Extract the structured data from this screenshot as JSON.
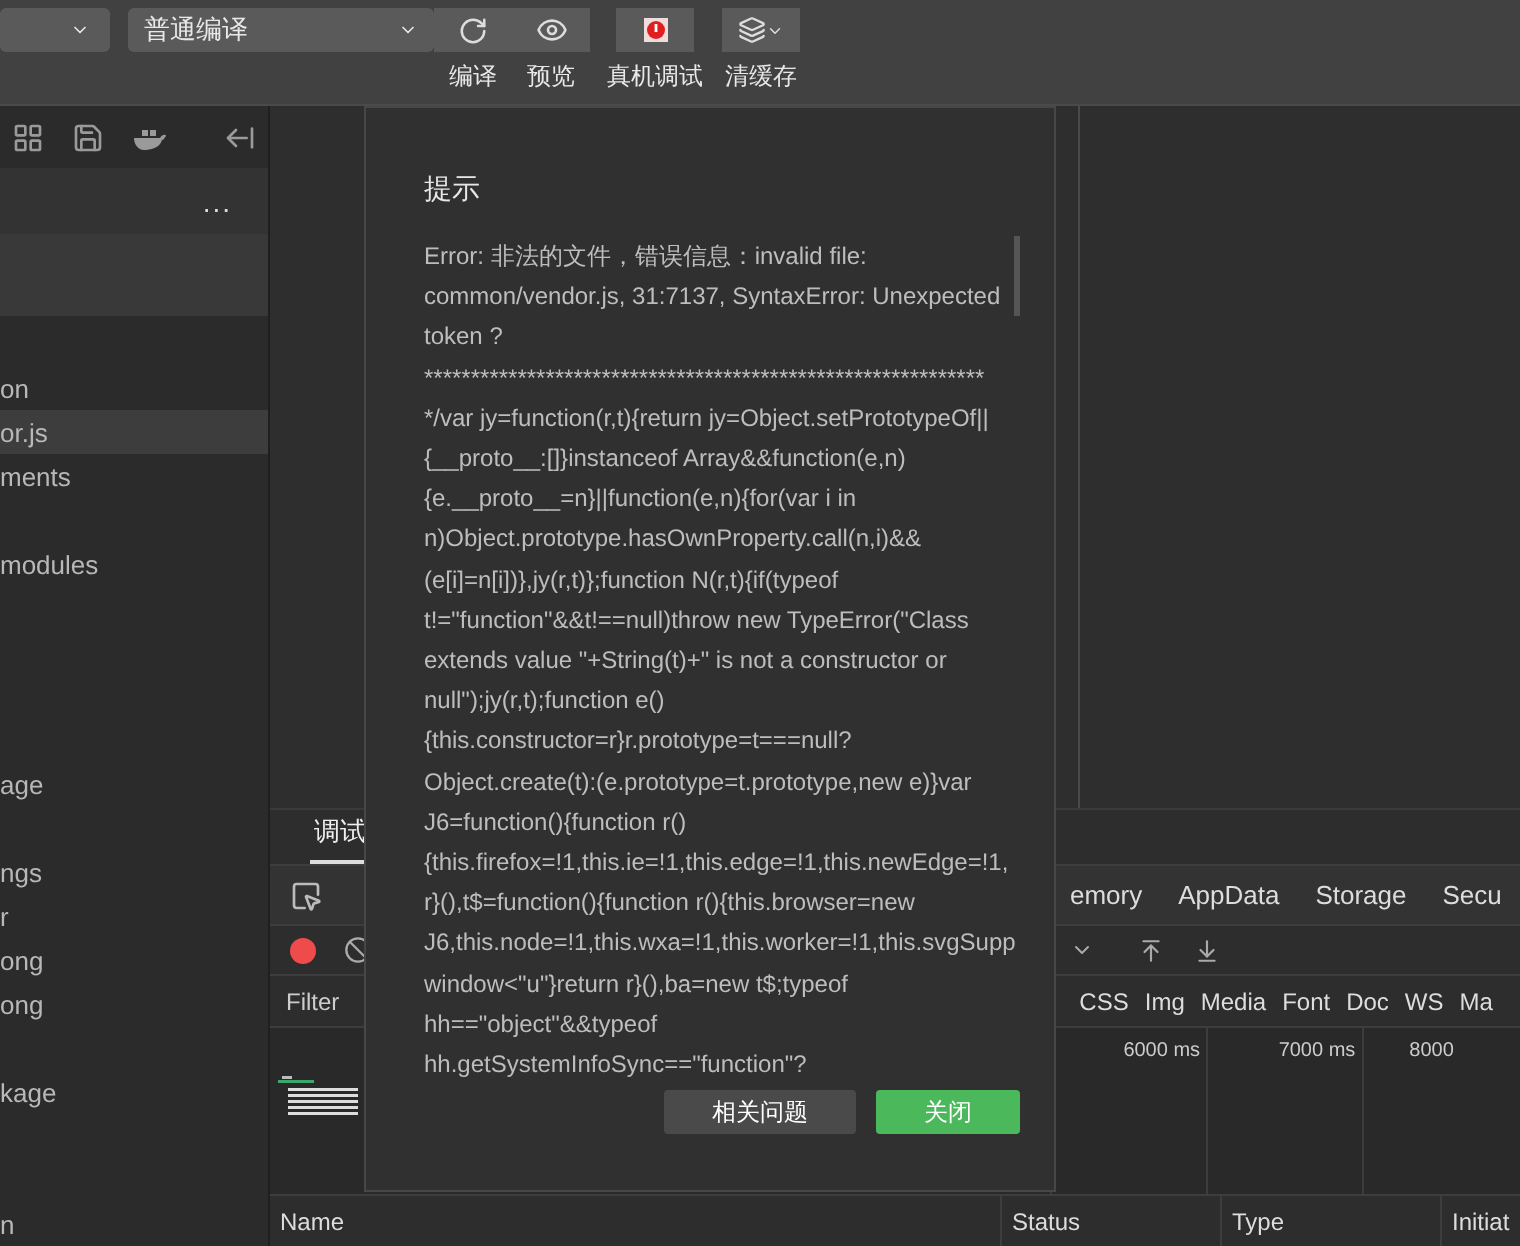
{
  "toolbar": {
    "mode_dropdown": {
      "value": "普通编译"
    },
    "buttons": [
      {
        "kind": "compile",
        "label": "编译"
      },
      {
        "kind": "preview",
        "label": "预览"
      },
      {
        "kind": "device",
        "label": "真机调试"
      },
      {
        "kind": "cache",
        "label": "清缓存"
      }
    ]
  },
  "sidebar": {
    "menu": "...",
    "files": [
      {
        "name": "on",
        "selected": false
      },
      {
        "name": "or.js",
        "selected": true
      },
      {
        "name": "ments",
        "selected": false
      },
      {
        "name": "modules",
        "selected": false
      },
      {
        "name": "age",
        "selected": false
      },
      {
        "name": "ngs",
        "selected": false
      },
      {
        "name": "r",
        "selected": false
      },
      {
        "name": "ong",
        "selected": false
      },
      {
        "name": "ong",
        "selected": false
      },
      {
        "name": "kage",
        "selected": false
      },
      {
        "name": "n",
        "selected": false
      }
    ]
  },
  "debugger": {
    "tabs": [
      {
        "label": "调试",
        "selected": true
      }
    ],
    "panels": [
      "emory",
      "AppData",
      "Storage",
      "Secu"
    ],
    "filter": "Filter",
    "types": [
      "CSS",
      "Img",
      "Media",
      "Font",
      "Doc",
      "WS",
      "Ma"
    ],
    "ticks": [
      "6000 ms",
      "7000 ms",
      "8000"
    ],
    "columns": [
      "Name",
      "Status",
      "Type",
      "Initiat"
    ]
  },
  "dialog": {
    "title": "提示",
    "lines": [
      "Error: 非法的文件，错误信息：invalid file:",
      "common/vendor.js, 31:7137, SyntaxError: Unexpected",
      "token ?",
      "************************************************************",
      "*/var jy=function(r,t){return jy=Object.setPrototypeOf||",
      "{__proto__:[]}instanceof Array&&function(e,n)",
      "{e.__proto__=n}||function(e,n){for(var i in",
      "n)Object.prototype.hasOwnProperty.call(n,i)&&",
      "(e[i]=n[i])},jy(r,t)};function N(r,t){if(typeof",
      "t!=\"function\"&&t!==null)throw new TypeError(\"Class",
      "extends value \"+String(t)+\" is not a constructor or",
      "null\");jy(r,t);function e()",
      "{this.constructor=r}r.prototype=t===null?",
      "Object.create(t):(e.prototype=t.prototype,new e)}var",
      "J6=function(){function r()",
      "{this.firefox=!1,this.ie=!1,this.edge=!1,this.newEdge=!1,",
      "r}(),t$=function(){function r(){this.browser=new",
      "J6,this.node=!1,this.wxa=!1,this.worker=!1,this.svgSupp",
      "window<\"u\"}return r}(),ba=new t$;typeof",
      "hh==\"object\"&&typeof",
      "hh.getSystemInfoSync==\"function\"?"
    ],
    "buttons": [
      {
        "kind": "secondary",
        "label": "相关问题"
      },
      {
        "kind": "primary",
        "label": "关闭"
      }
    ]
  }
}
